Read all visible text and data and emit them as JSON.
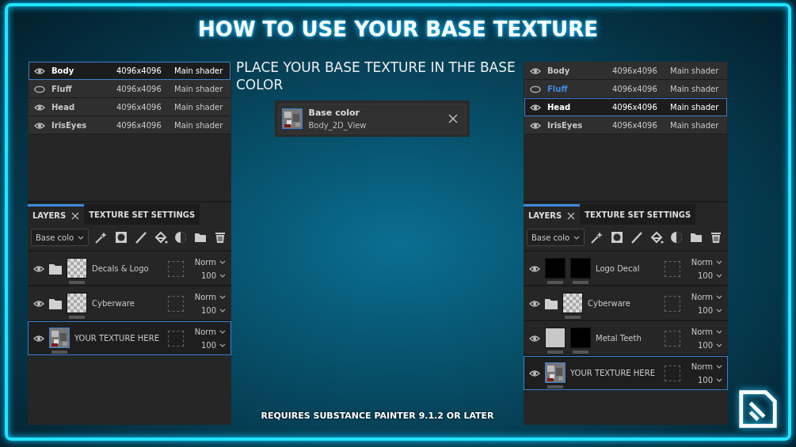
{
  "title": "HOW TO USE YOUR BASE TEXTURE",
  "panels": [
    {
      "texture_sets": [
        {
          "name": "Body",
          "resolution": "4096x4096",
          "shader": "Main shader",
          "visible": true,
          "selected": true,
          "highlighted": false
        },
        {
          "name": "Fluff",
          "resolution": "4096x4096",
          "shader": "Main shader",
          "visible": false,
          "selected": false,
          "highlighted": false
        },
        {
          "name": "Head",
          "resolution": "4096x4096",
          "shader": "Main shader",
          "visible": true,
          "selected": false,
          "highlighted": false
        },
        {
          "name": "IrisEyes",
          "resolution": "4096x4096",
          "shader": "Main shader",
          "visible": true,
          "selected": false,
          "highlighted": false
        }
      ],
      "tabs": [
        {
          "label": "LAYERS",
          "selected": true,
          "closable": true
        },
        {
          "label": "TEXTURE SET SETTINGS",
          "selected": false,
          "closable": false
        }
      ],
      "channel": "Base colo",
      "layers": [
        {
          "name": "Decals & Logo",
          "visible": true,
          "folder": true,
          "thumbs": [
            {
              "kind": "checker"
            }
          ],
          "blend": "Norm",
          "opacity": "100",
          "selected": false
        },
        {
          "name": "Cyberware",
          "visible": true,
          "folder": true,
          "thumbs": [
            {
              "kind": "checker"
            }
          ],
          "blend": "Norm",
          "opacity": "100",
          "selected": false
        },
        {
          "name": "YOUR TEXTURE HERE",
          "visible": true,
          "folder": false,
          "thumbs": [
            {
              "kind": "texture"
            }
          ],
          "blend": "Norm",
          "opacity": "100",
          "selected": true
        }
      ]
    },
    {
      "texture_sets": [
        {
          "name": "Body",
          "resolution": "4096x4096",
          "shader": "Main shader",
          "visible": true,
          "selected": false,
          "highlighted": false
        },
        {
          "name": "Fluff",
          "resolution": "4096x4096",
          "shader": "Main shader",
          "visible": false,
          "selected": false,
          "highlighted": true
        },
        {
          "name": "Head",
          "resolution": "4096x4096",
          "shader": "Main shader",
          "visible": true,
          "selected": true,
          "highlighted": false
        },
        {
          "name": "IrisEyes",
          "resolution": "4096x4096",
          "shader": "Main shader",
          "visible": true,
          "selected": false,
          "highlighted": false
        }
      ],
      "tabs": [
        {
          "label": "LAYERS",
          "selected": true,
          "closable": true
        },
        {
          "label": "TEXTURE SET SETTINGS",
          "selected": false,
          "closable": false
        }
      ],
      "channel": "Base colo",
      "layers": [
        {
          "name": "Logo Decal",
          "visible": true,
          "folder": false,
          "thumbs": [
            {
              "kind": "black"
            },
            {
              "kind": "black"
            }
          ],
          "blend": "Norm",
          "opacity": "100",
          "selected": false
        },
        {
          "name": "Cyberware",
          "visible": true,
          "folder": true,
          "thumbs": [
            {
              "kind": "checker"
            }
          ],
          "blend": "Norm",
          "opacity": "100",
          "selected": false
        },
        {
          "name": "Metal Teeth",
          "visible": true,
          "folder": false,
          "thumbs": [
            {
              "kind": "light"
            },
            {
              "kind": "black"
            }
          ],
          "blend": "Norm",
          "opacity": "100",
          "selected": false
        },
        {
          "name": "YOUR TEXTURE HERE",
          "visible": true,
          "folder": false,
          "thumbs": [
            {
              "kind": "texture"
            }
          ],
          "blend": "Norm",
          "opacity": "100",
          "selected": true
        }
      ]
    }
  ],
  "instruction": "PLACE YOUR BASE TEXTURE IN THE BASE COLOR",
  "slot": {
    "label": "Base color",
    "value": "Body_2D_View"
  },
  "footer": "REQUIRES SUBSTANCE PAINTER 9.1.2 OR LATER"
}
